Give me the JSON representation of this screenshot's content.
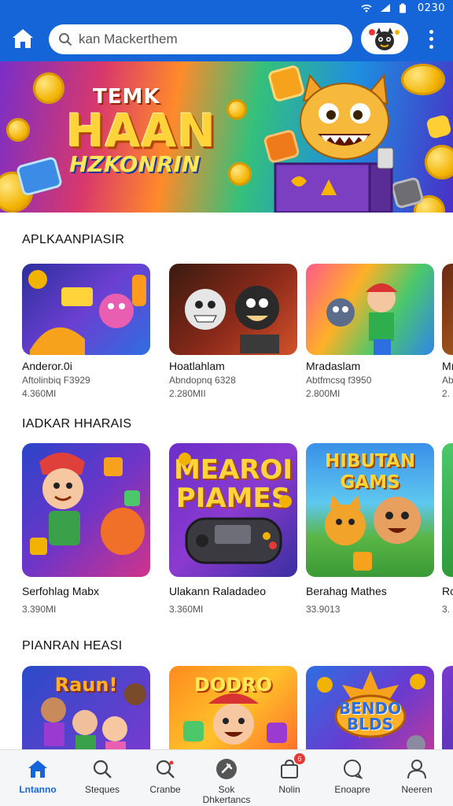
{
  "status_bar": {
    "time": "0230"
  },
  "app_bar": {
    "search_value": "kan Mackerthem",
    "icons": [
      "home-icon",
      "search-icon",
      "avatar-icon",
      "more-vertical-icon"
    ]
  },
  "banner": {
    "line1": "TEMK",
    "line2": "HAAN",
    "line3": "HZKONRIN"
  },
  "sections": [
    {
      "title": "APLKAANPIASIR",
      "cards": [
        {
          "name": "Anderor.0i",
          "sub": "Aftolinbiq F3929",
          "size": "4.360MI"
        },
        {
          "name": "Hoatlahlam",
          "sub": "Abndopnq 6328",
          "size": "2.280MII"
        },
        {
          "name": "Mradaslam",
          "sub": "Abtfmcsq f3950",
          "size": "2.800MI"
        },
        {
          "name": "Mı",
          "sub": "Ab",
          "size": "2."
        }
      ]
    },
    {
      "title": "IADKAR HHARAIS",
      "cards": [
        {
          "name": "Serfohlag Mabx",
          "sub": "",
          "size": "3.390MI"
        },
        {
          "name": "Ulakann Raladadeo",
          "sub": "",
          "size": "3.360MI"
        },
        {
          "name": "Berahag Mathes",
          "sub": "",
          "size": "33.9013"
        },
        {
          "name": "Rc",
          "sub": "",
          "size": "3."
        }
      ],
      "thumb_texts": [
        "",
        "MEAROI PIAMES",
        "HIBUTAN GAMS",
        ""
      ]
    },
    {
      "title": "PIANRAN HEASI",
      "cards": [
        {
          "name": "",
          "sub": "",
          "size": ""
        },
        {
          "name": "",
          "sub": "",
          "size": ""
        },
        {
          "name": "",
          "sub": "",
          "size": ""
        }
      ],
      "thumb_texts": [
        "Raun!",
        "DODRO",
        "BENDO BLDS"
      ]
    }
  ],
  "bottom_nav": [
    {
      "label": "Lntanno",
      "icon": "home-icon",
      "active": true
    },
    {
      "label": "Steques",
      "icon": "search-icon",
      "active": false
    },
    {
      "label": "Cranbe",
      "icon": "search-icon",
      "active": false
    },
    {
      "label": "Sok Dhkertancs",
      "icon": "games-icon",
      "active": false
    },
    {
      "label": "Nolin",
      "icon": "bag-icon",
      "active": false,
      "badge": "6"
    },
    {
      "label": "Enoapre",
      "icon": "chat-icon",
      "active": false
    },
    {
      "label": "Neeren",
      "icon": "profile-icon",
      "active": false
    }
  ],
  "colors": {
    "primary": "#1565d8",
    "nav_background": "#f5f6f8",
    "badge": "#e53935"
  }
}
